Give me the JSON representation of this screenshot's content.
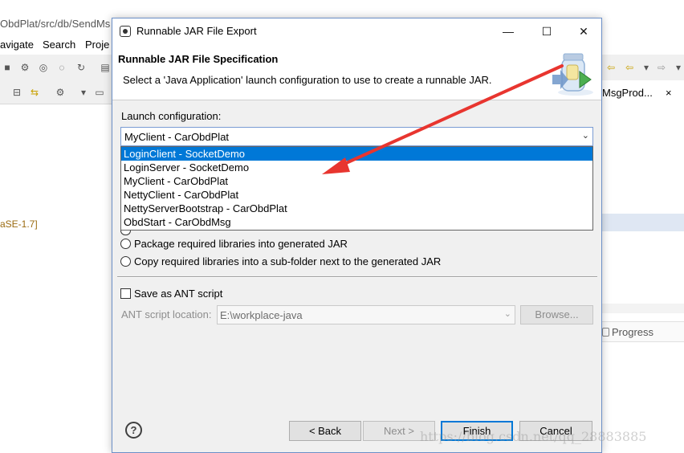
{
  "background": {
    "path_fragment": "ObdPlat/src/db/SendMs",
    "menu": [
      "avigate",
      "Search",
      "Proje"
    ],
    "jre_label": "aSE-1.7]",
    "tab_label": "MsgProd...",
    "tab_close": "×",
    "progress_label": "Progress"
  },
  "dialog": {
    "title": "Runnable JAR File Export",
    "minimize": "—",
    "maximize": "☐",
    "close": "✕",
    "header_title": "Runnable JAR File Specification",
    "header_desc": "Select a 'Java Application' launch configuration to use to create a runnable JAR.",
    "launch_label": "Launch configuration:",
    "launch_selected": "MyClient - CarObdPlat",
    "dropdown_options": [
      "LoginClient - SocketDemo",
      "LoginServer - SocketDemo",
      "MyClient - CarObdPlat",
      "NettyClient - CarObdPlat",
      "NettyServerBootstrap - CarObdPlat",
      "ObdStart - CarObdMsg"
    ],
    "highlighted_option_index": 0,
    "radio_package": "Package required libraries into generated JAR",
    "radio_copy": "Copy required libraries into a sub-folder next to the generated JAR",
    "save_ant": "Save as ANT script",
    "ant_location_label": "ANT script location:",
    "ant_location_value": "E:\\workplace-java",
    "browse": "Browse...",
    "help": "?",
    "back": "< Back",
    "next": "Next >",
    "finish": "Finish",
    "cancel": "Cancel"
  },
  "watermark": "https://blog.csdn.net/qq_28883885",
  "colors": {
    "selection": "#0078d7",
    "annotation_arrow": "#e8352f",
    "focus_border": "#7a9cd3"
  }
}
